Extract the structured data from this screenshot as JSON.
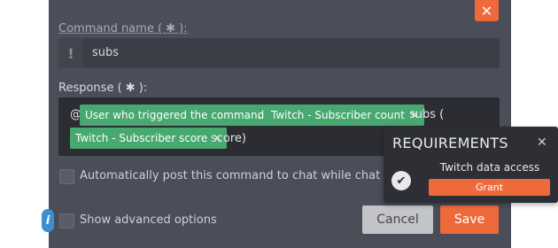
{
  "close_glyph": "✕",
  "command_name": {
    "label": "Command name ( ✱ ):",
    "value": "subs",
    "icon": "exclamation-icon",
    "icon_glyph": "!"
  },
  "response": {
    "label": "Response ( ✱ ):",
    "prefix": "@",
    "chips": [
      {
        "label": "User who triggered the command",
        "remove": "✕"
      },
      {
        "label": "Twitch - Subscriber count",
        "remove": "✕"
      },
      {
        "label": "Twitch - Subscriber score",
        "remove": "✕"
      }
    ],
    "text_comma": ",",
    "text_subs": "subs (",
    "text_score": "score)"
  },
  "options": {
    "auto_post": "Automatically post this command to chat while chat is active",
    "advanced": "Show advanced options"
  },
  "info_glyph": "i",
  "buttons": {
    "cancel": "Cancel",
    "save": "Save"
  },
  "requirements": {
    "title": "REQUIREMENTS",
    "close": "✕",
    "check": "✔",
    "item": "Twitch data access",
    "grant": "Grant"
  },
  "colors": {
    "accent": "#ee6a3b",
    "chip": "#47a870",
    "modal_bg": "#4b4e59",
    "info": "#3e8fd1"
  }
}
